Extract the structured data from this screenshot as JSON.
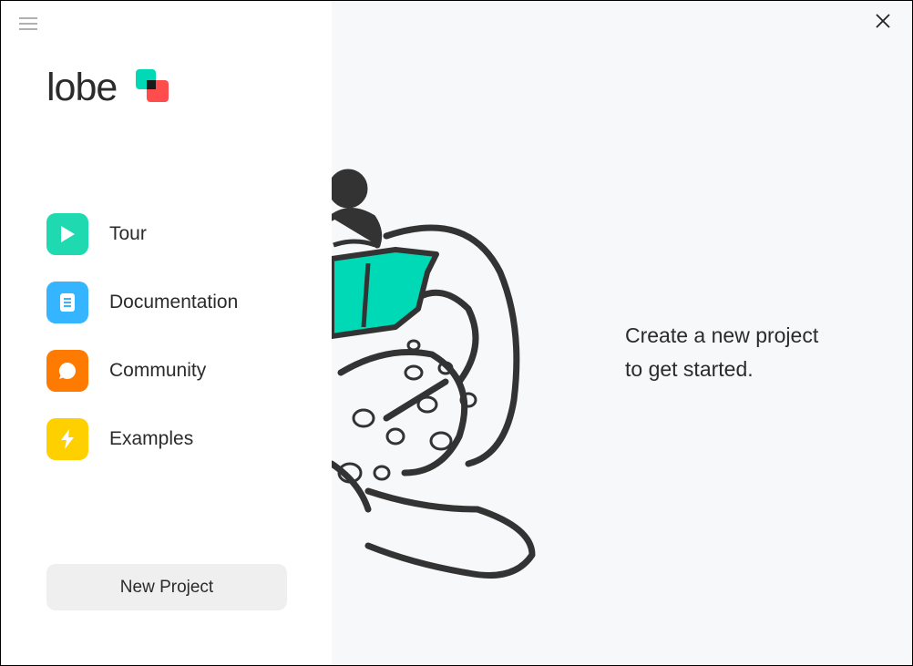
{
  "app": {
    "logo_text": "lobe",
    "brand_colors": {
      "primary": "#00d9b5",
      "secondary": "#ff4d4d"
    }
  },
  "sidebar": {
    "items": [
      {
        "label": "Tour",
        "icon": "play-icon",
        "color": "#1fd9b0"
      },
      {
        "label": "Documentation",
        "icon": "document-icon",
        "color": "#35b4ff"
      },
      {
        "label": "Community",
        "icon": "chat-bubble-icon",
        "color": "#ff7a00"
      },
      {
        "label": "Examples",
        "icon": "lightning-icon",
        "color": "#ffd000"
      }
    ],
    "new_project_label": "New Project"
  },
  "main": {
    "prompt_line1": "Create a new project",
    "prompt_line2": "to get started."
  }
}
